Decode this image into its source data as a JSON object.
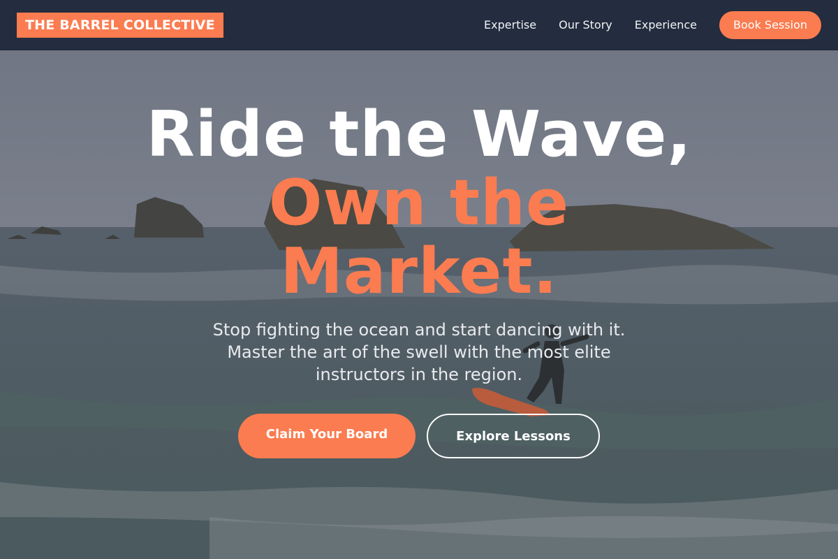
{
  "header": {
    "brand": "THE BARREL COLLECTIVE",
    "nav": [
      {
        "label": "Expertise"
      },
      {
        "label": "Our Story"
      },
      {
        "label": "Experience"
      }
    ],
    "cta_label": "Book Session"
  },
  "hero": {
    "headline_line1": "Ride the Wave,",
    "headline_line2": "Own the",
    "headline_line3": "Market.",
    "subtitle_lines": [
      "Stop fighting the ocean and start dancing with it.",
      "Master the art of the swell with the most elite",
      "instructors in the region."
    ],
    "primary_cta": "Claim Your Board",
    "secondary_cta": "Explore Lessons"
  },
  "colors": {
    "accent": "#fb7c50",
    "header_bg": "#232d3f",
    "text_light": "#ffffff"
  }
}
